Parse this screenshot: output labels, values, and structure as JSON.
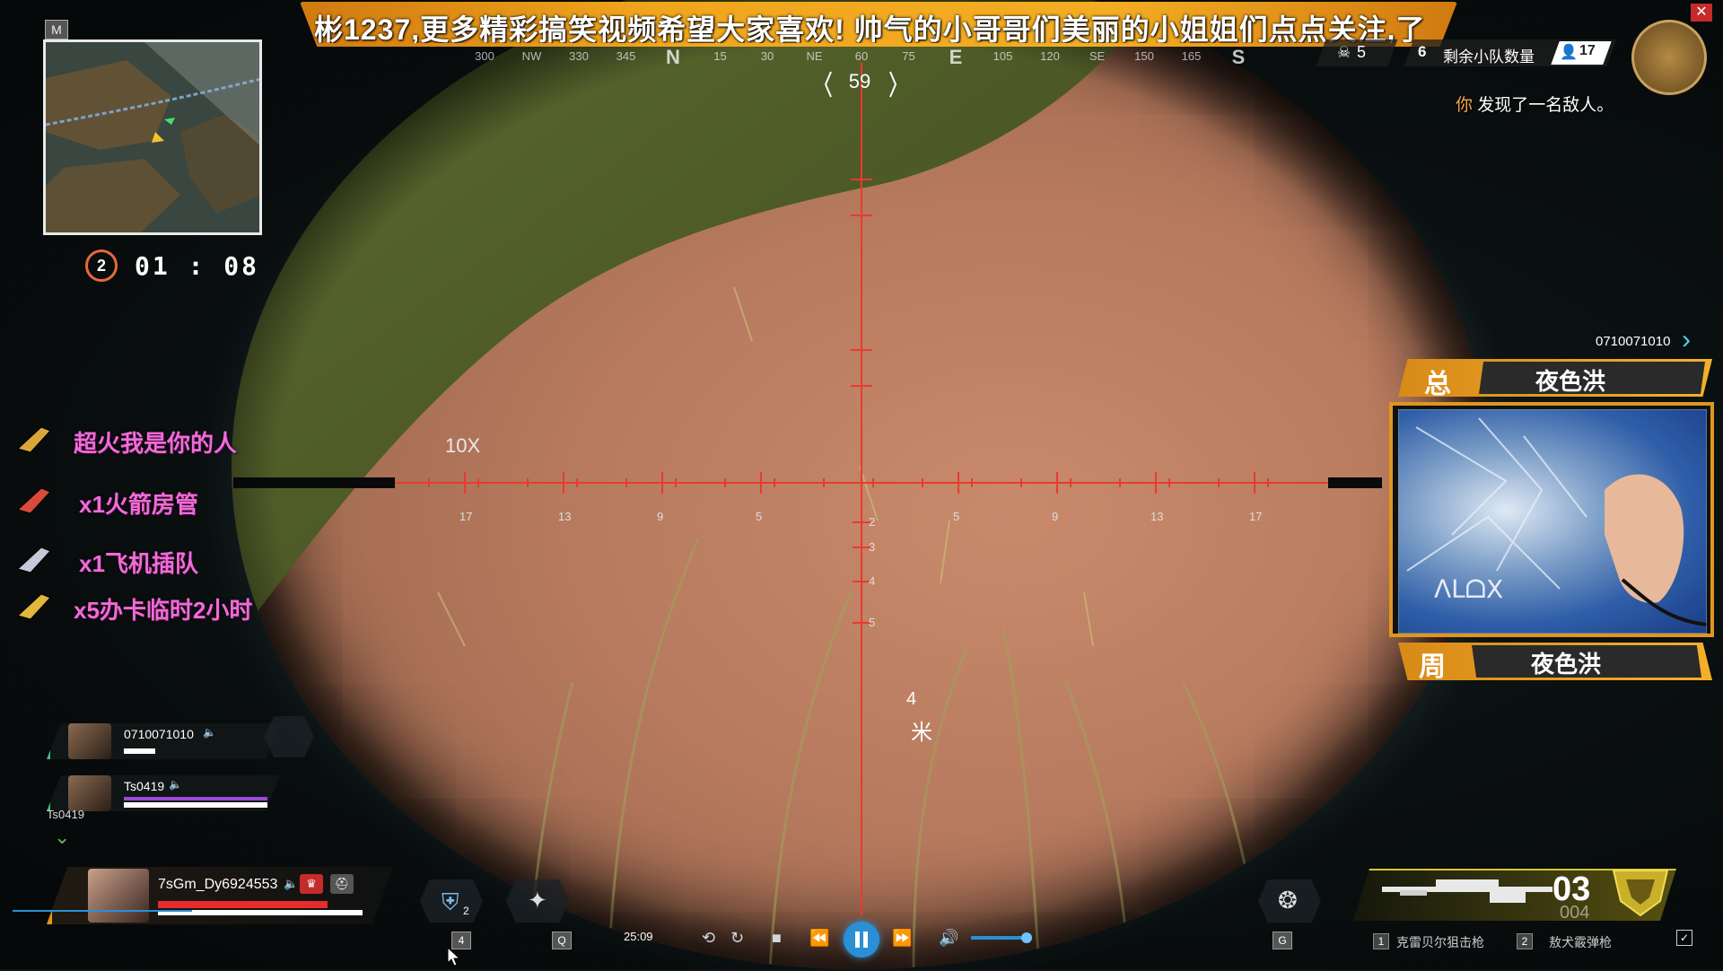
{
  "banner": {
    "text": "彬1237,更多精彩搞笑视频希望大家喜欢! 帅气的小哥哥们美丽的小姐姐们点点关注,了"
  },
  "compass": {
    "marks": [
      "300",
      "NW",
      "330",
      "345",
      "N",
      "15",
      "30",
      "NE",
      "60",
      "75",
      "E",
      "105",
      "120",
      "SE",
      "150",
      "165",
      "S"
    ],
    "bearing": "59"
  },
  "minimap": {
    "key": "M"
  },
  "ring": {
    "round": "2",
    "timer": "01 : 08"
  },
  "status": {
    "kills": "5",
    "squads_label": "剩余小队数量",
    "squads_count": "6",
    "players": "17"
  },
  "notification": {
    "prefix": "你",
    "text": "发现了一名敌人。"
  },
  "scope": {
    "zoom": "10X",
    "h_ticks": [
      "17",
      "13",
      "9",
      "5",
      "5",
      "9",
      "13",
      "17"
    ],
    "v_ticks": [
      "2",
      "3",
      "4",
      "5"
    ],
    "range_digit": "4",
    "range_unit": "米"
  },
  "gifts": [
    {
      "text": "超火我是你的人",
      "icon": "plane-icon"
    },
    {
      "text": "x1火箭房管",
      "icon": "rocket-icon"
    },
    {
      "text": "x1飞机插队",
      "icon": "jet-icon"
    },
    {
      "text": "x5办卡临时2小时",
      "icon": "card-icon"
    }
  ],
  "webcam": {
    "id": "0710071010",
    "top_tag": "总",
    "top_name": "夜色洪",
    "bottom_tag": "周",
    "bottom_name": "夜色洪",
    "pad_text": "ᐱᒪᗝX"
  },
  "team": [
    {
      "name": "0710071010",
      "health": 0.22
    },
    {
      "name": "Ts0419",
      "health": 1.0,
      "sub": "Ts0419"
    }
  ],
  "player": {
    "name": "7sGm_Dy6924553",
    "health": 0.82,
    "shield": 0.95
  },
  "abilities": {
    "tactical_key": "4",
    "ultimate_key": "Q",
    "grenade_key": "G",
    "tactical_count": "2"
  },
  "weapon": {
    "ammo": "03",
    "reserve": "004",
    "slot1_num": "1",
    "slot1": "克雷贝尔狙击枪",
    "slot2_num": "2",
    "slot2": "敖犬霰弹枪"
  },
  "playback": {
    "time": "25:09"
  },
  "colors": {
    "banner": "#f0a51c",
    "reticle": "#e83b2e",
    "gift_text": "#f06ad8",
    "hp": "#e82b2b",
    "accent": "#2b8fd6"
  }
}
